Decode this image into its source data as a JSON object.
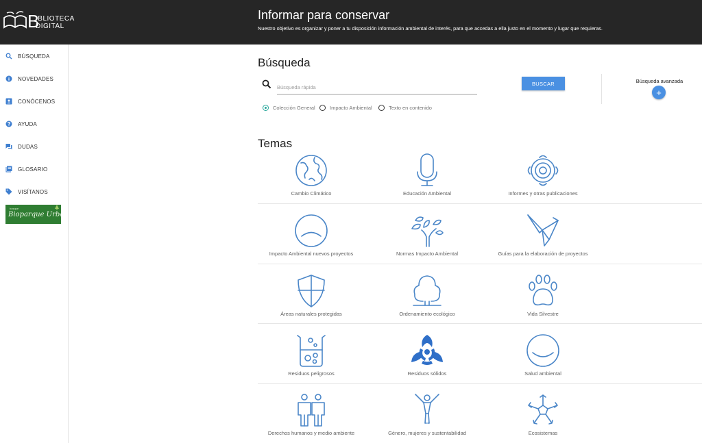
{
  "header": {
    "logo_b": "B",
    "logo_line1": "IBLIOTECA",
    "logo_line2": "DIGITAL",
    "title": "Informar para conservar",
    "subtitle": "Nuestro objetivo es organizar y poner a tu disposición información ambiental de interés, para que accedas a ella justo en el momento y lugar que requieras."
  },
  "sidebar": {
    "items": [
      {
        "label": "BÚSQUEDA",
        "icon": "search-icon"
      },
      {
        "label": "NOVEDADES",
        "icon": "info-icon"
      },
      {
        "label": "CONÓCENOS",
        "icon": "contact-card-icon"
      },
      {
        "label": "AYUDA",
        "icon": "help-icon"
      },
      {
        "label": "DUDAS",
        "icon": "chat-icon"
      },
      {
        "label": "GLOSARIO",
        "icon": "book-icon"
      },
      {
        "label": "VISÍTANOS",
        "icon": "tag-icon"
      }
    ],
    "banner": {
      "small": "bosque",
      "main": "Bioparque Urbano"
    }
  },
  "search": {
    "heading": "Búsqueda",
    "placeholder": "Búsqueda rápida",
    "button": "BUSCAR",
    "advanced_label": "Búsqueda avanzada",
    "advanced_button": "+",
    "options": [
      {
        "label": "Colección General",
        "selected": true
      },
      {
        "label": "Impacto Ambiental",
        "selected": false
      },
      {
        "label": "Texto en contenido",
        "selected": false
      }
    ]
  },
  "temas": {
    "heading": "Temas",
    "items": [
      {
        "label": "Cambio Climático",
        "icon": "globe-icon"
      },
      {
        "label": "Educación Ambiental",
        "icon": "microphone-icon"
      },
      {
        "label": "Informes y otras publicaciones",
        "icon": "target-icon"
      },
      {
        "label": "Impacto Ambiental nuevos proyectos",
        "icon": "circle-arc-icon"
      },
      {
        "label": "Normas Impacto Ambiental",
        "icon": "plant-icon"
      },
      {
        "label": "Guías para la elaboración de proyectos",
        "icon": "origami-bird-icon"
      },
      {
        "label": "Áreas naturales protegidas",
        "icon": "shield-icon"
      },
      {
        "label": "Ordenamiento ecológico",
        "icon": "tree-icon"
      },
      {
        "label": "Vida Silvestre",
        "icon": "paw-icon"
      },
      {
        "label": "Residuos peligrosos",
        "icon": "beaker-icon"
      },
      {
        "label": "Residuos sólidos",
        "icon": "biohazard-icon"
      },
      {
        "label": "Salud ambiental",
        "icon": "smile-circle-icon"
      },
      {
        "label": "Derechos humanos y medio ambiente",
        "icon": "people-icon"
      },
      {
        "label": "Género, mujeres y sustentabilidad",
        "icon": "woman-icon"
      },
      {
        "label": "Ecosistemas",
        "icon": "snowflake-icon"
      }
    ]
  },
  "colors": {
    "accent": "#4a90e2",
    "header": "#262626",
    "icon": "#4a86c8",
    "radio_on": "#26a69a",
    "banner": "#2f7d32"
  }
}
